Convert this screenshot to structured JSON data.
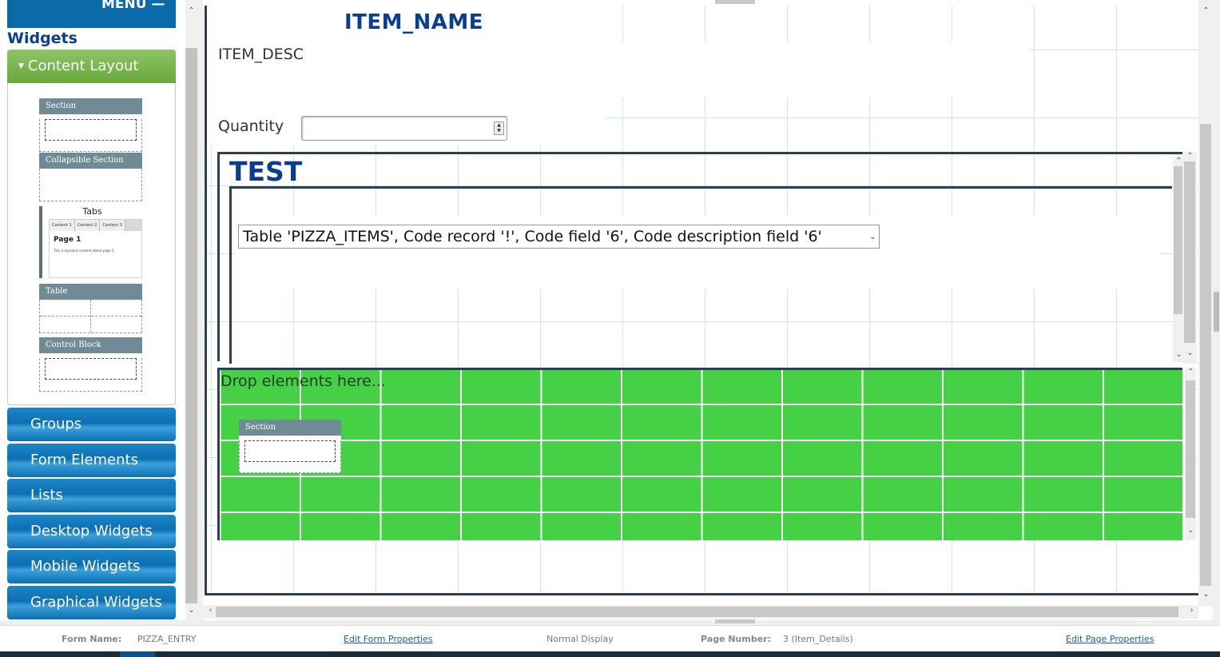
{
  "sidebar": {
    "menu_label": "MENU —",
    "title": "Widgets",
    "active_section": "Content Layout",
    "templates": {
      "section": "Section",
      "collapsible": "Collapsible Section",
      "tabs": "Tabs",
      "tabs_strip": [
        "Content 1",
        "Content 2",
        "Content 3"
      ],
      "tabs_page": "Page 1",
      "tabs_text": "This is dynamic content about page 1.",
      "table": "Table",
      "control_block": "Control Block"
    },
    "categories": [
      "Groups",
      "Form Elements",
      "Lists",
      "Desktop Widgets",
      "Mobile Widgets",
      "Graphical Widgets"
    ]
  },
  "form": {
    "item_name": "ITEM_NAME",
    "item_desc": "ITEM_DESC",
    "quantity_label": "Quantity",
    "quantity_value": "",
    "group_title": "TEST",
    "select_value": "Table 'PIZZA_ITEMS', Code record '!', Code field '6', Code description field '6'",
    "drop_hint": "Drop elements here...",
    "dropped_section": "Section"
  },
  "status": {
    "form_name_label": "Form Name:",
    "form_name": "PIZZA_ENTRY",
    "edit_form_link": "Edit Form Properties",
    "display_mode": "Normal Display",
    "page_number_label": "Page Number:",
    "page_number": "3 (Item_Details)",
    "edit_page_link": "Edit Page Properties"
  },
  "colors": {
    "accent_blue": "#0b6aa8",
    "title_blue": "#0b3d91",
    "accordion_green": "#6aa83e",
    "drop_green": "#46d046"
  }
}
